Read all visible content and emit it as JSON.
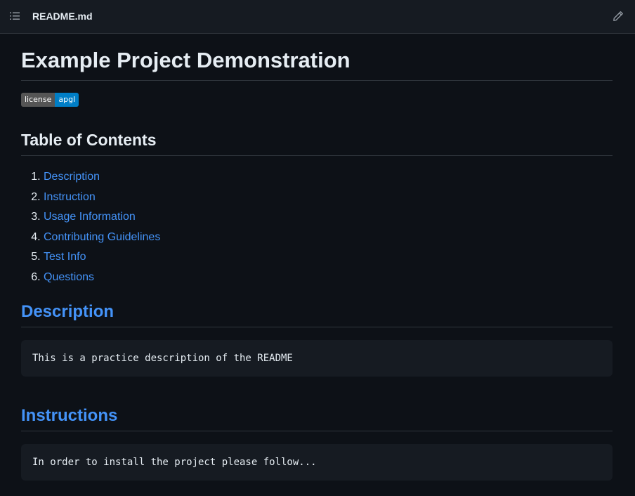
{
  "header": {
    "file_name": "README.md",
    "toc_icon": "list-unordered-icon",
    "edit_icon": "pencil-icon"
  },
  "readme": {
    "title": "Example Project Demonstration",
    "badge": {
      "label": "license",
      "value": "apgl",
      "label_color": "#555555",
      "value_color": "#007ec6"
    },
    "toc_heading": "Table of Contents",
    "toc": [
      "Description",
      "Instruction",
      "Usage Information",
      "Contributing Guidelines",
      "Test Info",
      "Questions"
    ],
    "sections": [
      {
        "heading": "Description",
        "code": "This is a practice description of the README"
      },
      {
        "heading": "Instructions",
        "code": "In order to install the project please follow..."
      }
    ]
  },
  "colors": {
    "background": "#0d1117",
    "header_background": "#161b22",
    "link": "#4493f8",
    "text": "#e6edf3",
    "border": "#30363d"
  }
}
